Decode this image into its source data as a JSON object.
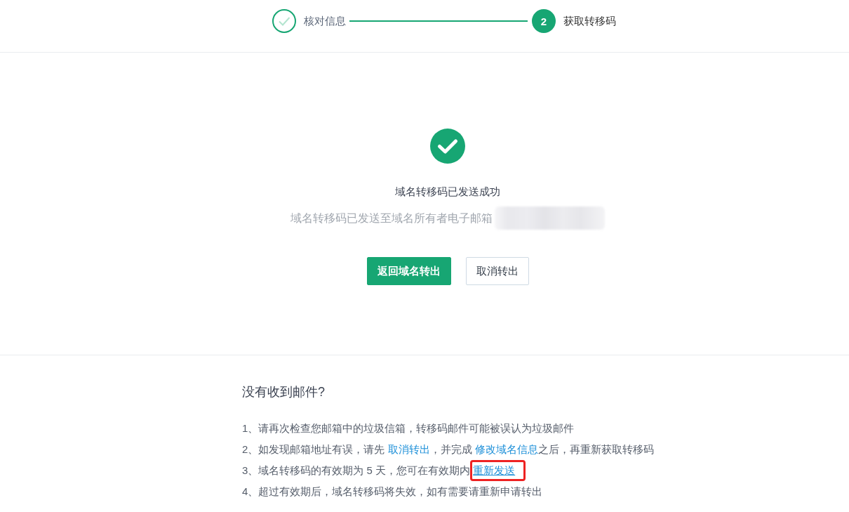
{
  "steps": [
    {
      "label": "核对信息",
      "done": true
    },
    {
      "label": "获取转移码",
      "done": false,
      "number": "2"
    }
  ],
  "result": {
    "title": "域名转移码已发送成功",
    "message": "域名转移码已发送至域名所有者电子邮箱",
    "email_blurred": true,
    "buttons": [
      {
        "label": "返回域名转出",
        "kind": "primary"
      },
      {
        "label": "取消转出",
        "kind": "default"
      }
    ]
  },
  "help": {
    "title": "没有收到邮件?",
    "items": [
      {
        "parts": [
          {
            "text": "1、请再次检查您邮箱中的垃圾信箱，转移码邮件可能被误认为垃圾邮件"
          }
        ]
      },
      {
        "parts": [
          {
            "text": "2、如发现邮箱地址有误，请先 "
          },
          {
            "link": "取消转出",
            "highlighted": false
          },
          {
            "text": "，并完成 "
          },
          {
            "link": "修改域名信息",
            "highlighted": false
          },
          {
            "text": "之后，再重新获取转移码"
          }
        ]
      },
      {
        "parts": [
          {
            "text": "3、域名转移码的有效期为 5 天，您可在有效期内 "
          },
          {
            "link": "重新发送",
            "highlighted": true
          }
        ]
      },
      {
        "parts": [
          {
            "text": "4、超过有效期后，域名转移码将失效，如有需要请重新申请转出"
          }
        ]
      }
    ]
  }
}
